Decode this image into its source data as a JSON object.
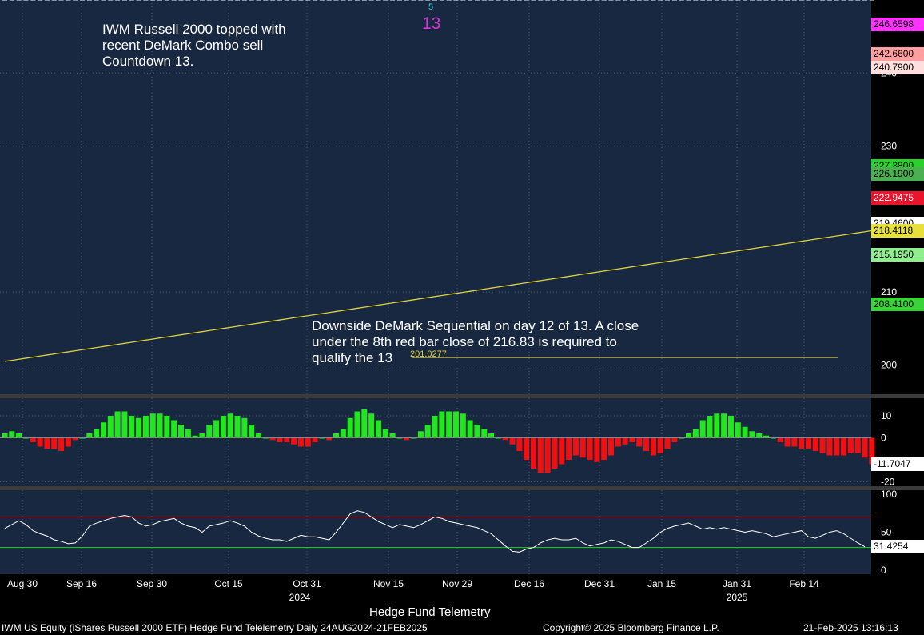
{
  "chart_data": [
    {
      "type": "candlestick",
      "panel": "price",
      "ylim": [
        196,
        250
      ],
      "yticks": [
        "200",
        "210",
        "230",
        "240"
      ],
      "price_tags": [
        {
          "text": "246.6598",
          "bg": "#ff33ff",
          "fg": "#000"
        },
        {
          "text": "242.6600",
          "bg": "#ff9f9f",
          "fg": "#000"
        },
        {
          "text": "240.7900",
          "bg": "#ffdede",
          "fg": "#000"
        },
        {
          "text": "227.3800",
          "bg": "#2bd12b",
          "fg": "#000"
        },
        {
          "text": "226.1900",
          "bg": "#4caf50",
          "fg": "#000"
        },
        {
          "text": "222.9475",
          "bg": "#e8152d",
          "fg": "#fff"
        },
        {
          "text": "219.4600",
          "bg": "#ffffff",
          "fg": "#000"
        },
        {
          "text": "218.4118",
          "bg": "#e8e03a",
          "fg": "#000"
        },
        {
          "text": "215.1950",
          "bg": "#90ee90",
          "fg": "#000"
        },
        {
          "text": "208.4100",
          "bg": "#3ad33a",
          "fg": "#000"
        }
      ],
      "price_levels": {
        "last": 219.46,
        "ma_long": 218.4118,
        "ma_short": 222.9475,
        "ma_mid": 226.19
      },
      "annotations": [
        {
          "text": "IWM Russell 2000 topped with\nrecent DeMark Combo sell\nCountdown 13."
        },
        {
          "text": "Downside DeMark Sequential on day 12 of 13.  A close\nunder the 8th red bar close of 216.83 is required to\nqualify the 13"
        }
      ],
      "level_label": "201.0277",
      "demark_top_labels": [
        "5",
        "13"
      ],
      "colors": {
        "bg": "#182840",
        "up": "#ffffff",
        "ma_long": "#e0d03a",
        "ma_short": "#e8153a",
        "ma_mid": "#5a8a1a"
      }
    },
    {
      "type": "bar",
      "panel": "histogram",
      "ylim": [
        -22,
        18
      ],
      "yticks": [
        "10",
        "0",
        "-20"
      ],
      "last_tag": {
        "text": "-11.7047",
        "bg": "#ffffff",
        "fg": "#000"
      },
      "values": [
        2,
        3,
        2,
        0,
        -2,
        -4,
        -5,
        -5,
        -6,
        -4,
        -1,
        0,
        2,
        4,
        7,
        10,
        12,
        12,
        10,
        9,
        10,
        11,
        11,
        10,
        8,
        6,
        4,
        1,
        2,
        6,
        8,
        10,
        11,
        10,
        9,
        6,
        2,
        0,
        -1,
        -2,
        -2,
        -3,
        -4,
        -4,
        -2,
        0,
        -1,
        2,
        4,
        9,
        12,
        13,
        11,
        8,
        4,
        2,
        0,
        -1,
        0,
        3,
        6,
        10,
        12,
        12,
        12,
        11,
        8,
        6,
        4,
        2,
        0,
        -1,
        -3,
        -6,
        -10,
        -14,
        -16,
        -16,
        -14,
        -12,
        -10,
        -8,
        -9,
        -10,
        -11,
        -10,
        -8,
        -4,
        -3,
        -2,
        -4,
        -6,
        -8,
        -7,
        -5,
        -2,
        0,
        2,
        4,
        8,
        10,
        11,
        11,
        10,
        7,
        5,
        3,
        2,
        1,
        0,
        -2,
        -4,
        -4,
        -5,
        -5,
        -6,
        -7,
        -8,
        -8,
        -8,
        -7,
        -7,
        -9,
        -12
      ],
      "colors": {
        "pos": "#22e61e",
        "neg": "#ef1111"
      }
    },
    {
      "type": "line",
      "panel": "rsi",
      "ylim": [
        -5,
        105
      ],
      "yticks": [
        "100",
        "50",
        "0"
      ],
      "upper_band": 70,
      "lower_band": 30,
      "last_tag": {
        "text": "31.4254",
        "bg": "#ffffff",
        "fg": "#000"
      },
      "values": [
        55,
        60,
        65,
        60,
        52,
        48,
        45,
        40,
        38,
        35,
        36,
        45,
        58,
        62,
        65,
        68,
        70,
        72,
        70,
        62,
        58,
        60,
        64,
        66,
        68,
        62,
        58,
        56,
        50,
        58,
        60,
        62,
        65,
        62,
        58,
        50,
        45,
        42,
        40,
        40,
        38,
        42,
        46,
        44,
        44,
        42,
        40,
        50,
        62,
        74,
        78,
        76,
        70,
        64,
        60,
        56,
        60,
        58,
        56,
        60,
        65,
        70,
        68,
        64,
        62,
        60,
        58,
        56,
        52,
        48,
        40,
        32,
        25,
        24,
        28,
        30,
        36,
        40,
        42,
        40,
        40,
        42,
        36,
        32,
        34,
        36,
        40,
        38,
        34,
        30,
        30,
        36,
        42,
        50,
        55,
        58,
        60,
        62,
        58,
        54,
        56,
        54,
        56,
        54,
        52,
        50,
        52,
        50,
        48,
        44,
        46,
        48,
        50,
        52,
        44,
        42,
        46,
        50,
        52,
        48,
        42,
        36,
        31
      ],
      "colors": {
        "line": "#ffffff",
        "upper": "#e81010",
        "lower": "#1fd61f"
      }
    }
  ],
  "x_axis": {
    "labels": [
      "Aug 30",
      "Sep 16",
      "Sep 30",
      "Oct 15",
      "Oct 31",
      "Nov 15",
      "Nov 29",
      "Dec 16",
      "Dec 31",
      "Jan 15",
      "Jan 31",
      "Feb 14"
    ],
    "years": [
      "2024",
      "2025"
    ]
  },
  "subtitle": "Hedge Fund Telemetry",
  "footer": {
    "left": "IWM US Equity (iShares Russell 2000 ETF) Hedge Fund Telelemetry  Daily 24AUG2024-21FEB2025",
    "center": "Copyright© 2025 Bloomberg Finance L.P.",
    "right": "21-Feb-2025 13:16:13"
  }
}
